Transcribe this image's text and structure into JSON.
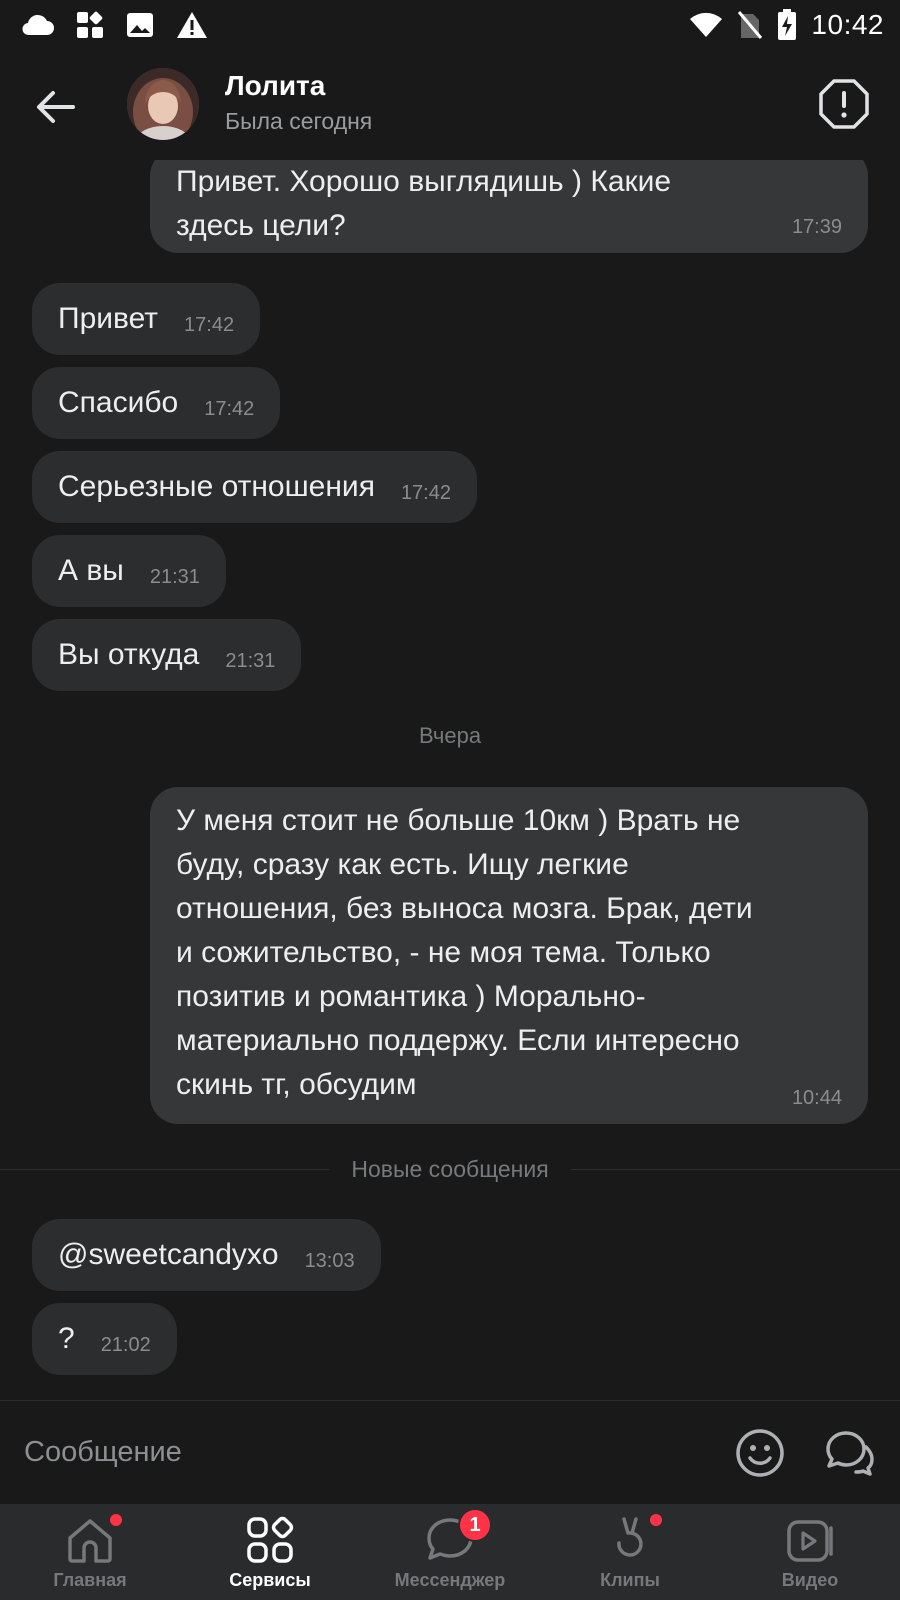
{
  "status_bar": {
    "time": "10:42",
    "left_icons": [
      "cloud-icon",
      "apps-icon",
      "image-icon",
      "warning-icon"
    ],
    "right_icons": [
      "wifi-icon",
      "no-sim-icon",
      "battery-charging-icon"
    ]
  },
  "header": {
    "name": "Лолита",
    "status": "Была сегодня"
  },
  "messages": [
    {
      "dir": "out",
      "text": "Привет. Хорошо выглядишь ) Какие\nздесь цели?",
      "time": "17:39"
    },
    {
      "dir": "in",
      "text": "Привет",
      "time": "17:42"
    },
    {
      "dir": "in",
      "text": "Спасибо",
      "time": "17:42"
    },
    {
      "dir": "in",
      "text": "Серьезные отношения",
      "time": "17:42"
    },
    {
      "dir": "in",
      "text": "А вы",
      "time": "21:31"
    },
    {
      "dir": "in",
      "text": "Вы откуда",
      "time": "21:31"
    },
    {
      "dir": "out",
      "text": "У меня стоит не больше 10км ) Врать не\nбуду, сразу как есть. Ищу легкие\nотношения, без выноса мозга. Брак, дети\nи сожительство, - не моя тема. Только\nпозитив и романтика ) Морально-\nматериально поддержу. Если интересно\nскинь тг, обсудим",
      "time": "10:44"
    },
    {
      "dir": "in",
      "text": "@sweetcandyxo",
      "time": "13:03"
    },
    {
      "dir": "in",
      "text": "?",
      "time": "21:02"
    }
  ],
  "separators": {
    "day": "Вчера",
    "new_messages": "Новые сообщения"
  },
  "composer": {
    "placeholder": "Сообщение"
  },
  "tabs": [
    {
      "label": "Главная",
      "icon": "home-icon",
      "dot": true
    },
    {
      "label": "Сервисы",
      "icon": "services-icon",
      "active": true
    },
    {
      "label": "Мессенджер",
      "icon": "messenger-icon",
      "badge": "1"
    },
    {
      "label": "Клипы",
      "icon": "clips-icon",
      "dot": true
    },
    {
      "label": "Видео",
      "icon": "video-icon"
    }
  ],
  "colors": {
    "background": "#19191a",
    "incoming_bubble": "#2c2d2e",
    "outgoing_bubble": "#363738",
    "badge": "#ff3347"
  }
}
